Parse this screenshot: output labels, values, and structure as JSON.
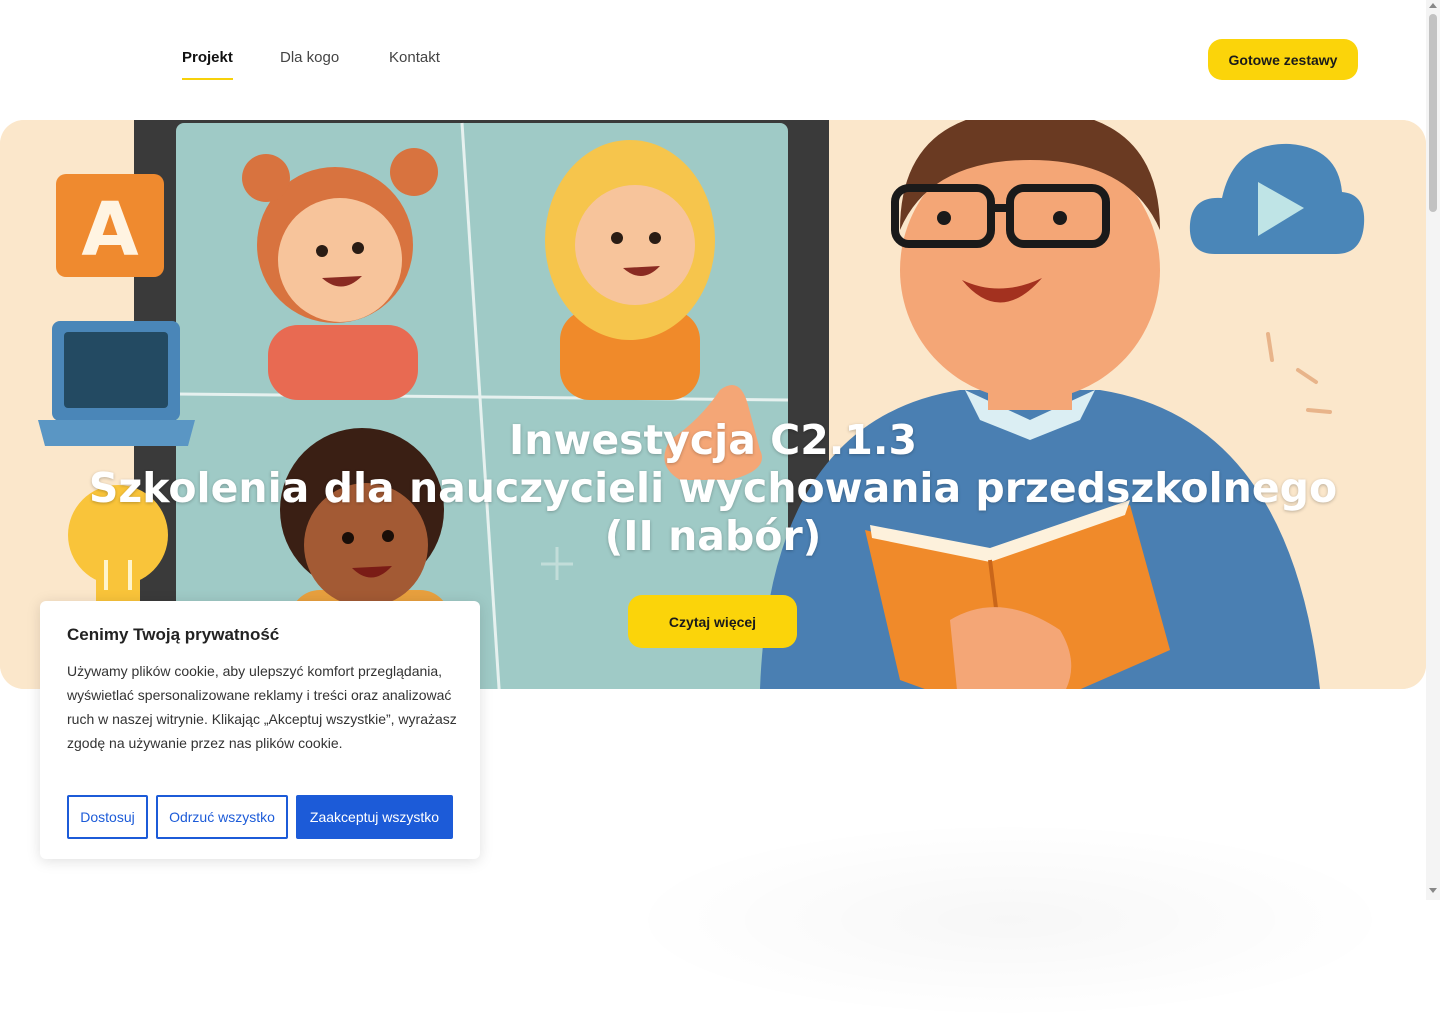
{
  "nav": {
    "items": [
      {
        "label": "Projekt",
        "active": true
      },
      {
        "label": "Dla kogo",
        "active": false
      },
      {
        "label": "Kontakt",
        "active": false
      }
    ],
    "cta_label": "Gotowe zestawy"
  },
  "hero": {
    "title_line1": "Inwestycja C2.1.3",
    "title_line2": "Szkolenia dla nauczycieli wychowania przedszkolnego",
    "title_line3": "(II nabór)",
    "cta_label": "Czytaj więcej",
    "illustration_letter": "A"
  },
  "cookie": {
    "title": "Cenimy Twoją prywatność",
    "text": "Używamy plików cookie, aby ulepszyć komfort przeglądania, wyświetlać spersonalizowane reklamy i treści oraz analizować ruch w naszej witrynie. Klikając „Akceptuj wszystkie”, wyrażasz zgodę na używanie przez nas plików cookie.",
    "customize_label": "Dostosuj",
    "reject_label": "Odrzuć wszystko",
    "accept_label": "Zaakceptuj wszystko"
  },
  "colors": {
    "accent_yellow": "#fbd40a",
    "cookie_blue": "#1c5bd8",
    "hero_bg": "#fbe7cb"
  }
}
